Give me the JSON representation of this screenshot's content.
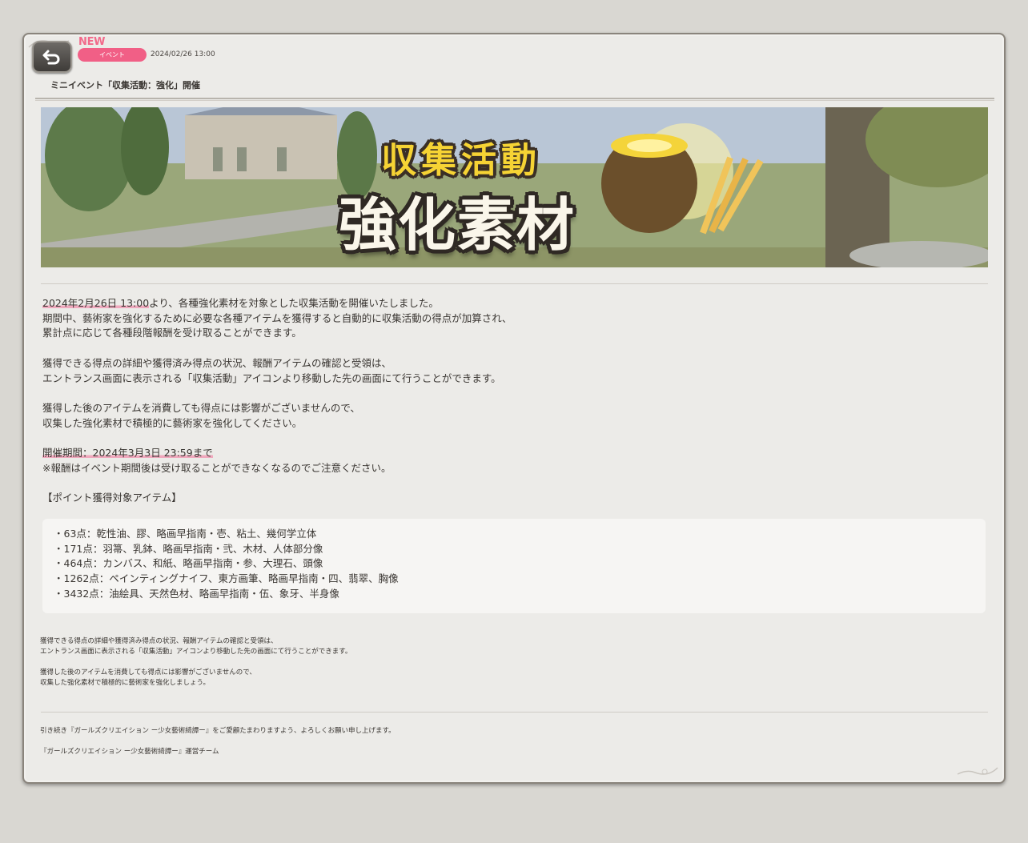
{
  "notice": {
    "new_label": "NEW",
    "category": "イベント",
    "date": "2024/02/26 13:00",
    "title": "ミニイベント「収集活動：強化」開催",
    "back_icon": "back-arrow-icon"
  },
  "banner": {
    "line1": "収集活動",
    "line2": "強化素材"
  },
  "body": {
    "p1_highlight": "2024年2月26日 13:00",
    "p1_rest": "より、各種強化素材を対象とした収集活動を開催いたしました。",
    "p1_line2": "期間中、藝術家を強化するために必要な各種アイテムを獲得すると自動的に収集活動の得点が加算され、",
    "p1_line3": "累計点に応じて各種段階報酬を受け取ることができます。",
    "p2_line1": "獲得できる得点の詳細や獲得済み得点の状況、報酬アイテムの確認と受領は、",
    "p2_line2": "エントランス画面に表示される「収集活動」アイコンより移動した先の画面にて行うことができます。",
    "p3_line1": "獲得した後のアイテムを消費しても得点には影響がございませんので、",
    "p3_line2": "収集した強化素材で積極的に藝術家を強化してください。",
    "period_highlight": "開催期間：2024年3月3日 23:59まで",
    "period_note": "※報酬はイベント期間後は受け取ることができなくなるのでご注意ください。",
    "items_heading": "【ポイント獲得対象アイテム】"
  },
  "items": [
    "・63点：乾性油、膠、略画早指南・壱、粘土、幾何学立体",
    "・171点：羽箒、乳鉢、略画早指南・弐、木材、人体部分像",
    "・464点：カンバス、和紙、略画早指南・参、大理石、頭像",
    "・1262点：ペインティングナイフ、東方画筆、略画早指南・四、翡翠、胸像",
    "・3432点：油絵具、天然色材、略画早指南・伍、象牙、半身像"
  ],
  "small": {
    "line1": "獲得できる得点の詳細や獲得済み得点の状況、報酬アイテムの確認と受領は、",
    "line2": "エントランス画面に表示される「収集活動」アイコンより移動した先の画面にて行うことができます。",
    "line3": "獲得した後のアイテムを消費しても得点には影響がございませんので、",
    "line4": "収集した強化素材で積極的に藝術家を強化しましょう。"
  },
  "closing": {
    "line1": "引き続き『ガールズクリエイション ー少女藝術綺譚ー』をご愛顧たまわりますよう、よろしくお願い申し上げます。",
    "line2": "『ガールズクリエイション ー少女藝術綺譚ー』運営チーム"
  },
  "colors": {
    "accent_pink": "#f15f86",
    "highlight": "#f0a8bd",
    "panel_bg": "#ecebe8"
  }
}
